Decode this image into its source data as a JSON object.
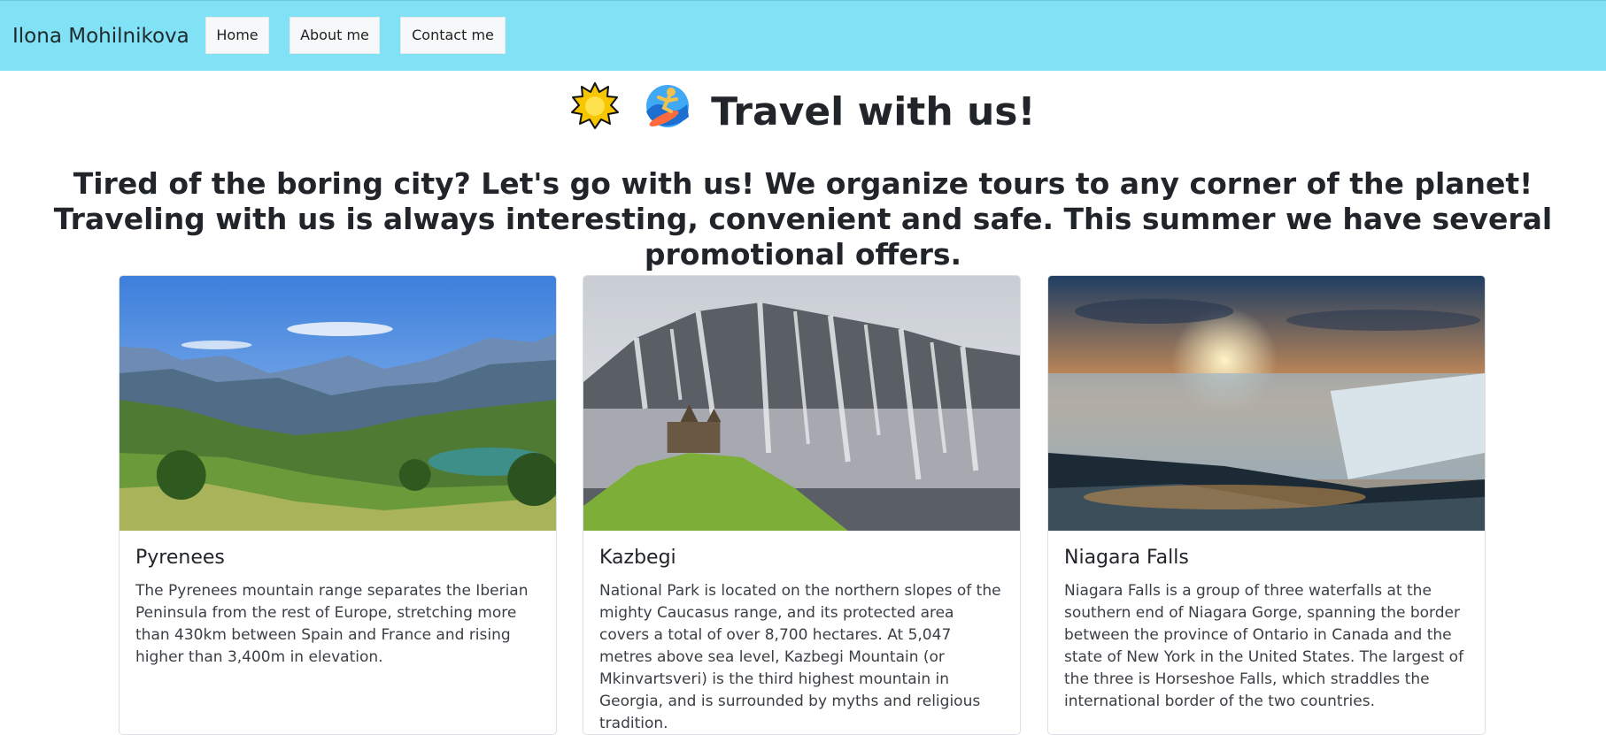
{
  "navbar": {
    "brand": "Ilona Mohilnikova",
    "links": [
      {
        "label": "Home"
      },
      {
        "label": "About me"
      },
      {
        "label": "Contact me"
      }
    ],
    "background": "#80e2f4"
  },
  "hero": {
    "emoji_icons": [
      "sun-icon",
      "surfer-icon"
    ],
    "title": "Travel with us!",
    "description": "Tired of the boring city? Let's go with us! We organize tours to any corner of the planet! Traveling with us is always interesting, convenient and safe. This summer we have several promotional offers."
  },
  "cards": [
    {
      "image": "pyrenees-photo",
      "title": "Pyrenees",
      "text": "The Pyrenees mountain range separates the Iberian Peninsula from the rest of Europe, stretching more than 430km between Spain and France and rising higher than 3,400m in elevation."
    },
    {
      "image": "kazbegi-photo",
      "title": "Kazbegi",
      "text": "National Park is located on the northern slopes of the mighty Caucasus range, and its protected area covers a total of over 8,700 hectares. At 5,047 metres above sea level, Kazbegi Mountain (or Mkinvartsveri) is the third highest mountain in Georgia, and is surrounded by myths and religious tradition."
    },
    {
      "image": "niagara-falls-photo",
      "title": "Niagara Falls",
      "text": "Niagara Falls is a group of three waterfalls at the southern end of Niagara Gorge, spanning the border between the province of Ontario in Canada and the state of New York in the United States. The largest of the three is Horseshoe Falls, which straddles the international border of the two countries."
    }
  ]
}
